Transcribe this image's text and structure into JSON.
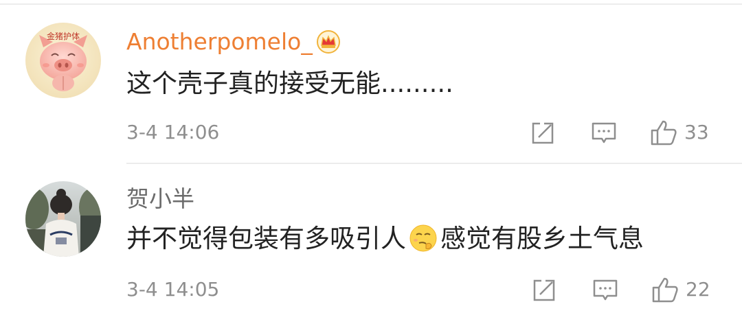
{
  "comments": [
    {
      "username": "Anotherpomelo_",
      "username_color": "#ee7f33",
      "badge_icon": "crown-icon",
      "avatar_icon": "pig-avatar",
      "avatar_text": "金猪护体",
      "text": "这个壳子真的接受无能.........",
      "time": "3-4 14:06",
      "likes": "33"
    },
    {
      "username": "贺小半",
      "username_color": "#6b6b6b",
      "avatar_icon": "girl-photo-avatar",
      "text_before_emoji": "并不觉得包装有多吸引人",
      "emoji_icon": "thinking-emoji",
      "text_after_emoji": "感觉有股乡土气息",
      "time": "3-4 14:05",
      "likes": "22"
    }
  ],
  "actions": {
    "repost_icon": "repost-icon",
    "reply_icon": "comment-icon",
    "like_icon": "thumbs-up-icon"
  }
}
